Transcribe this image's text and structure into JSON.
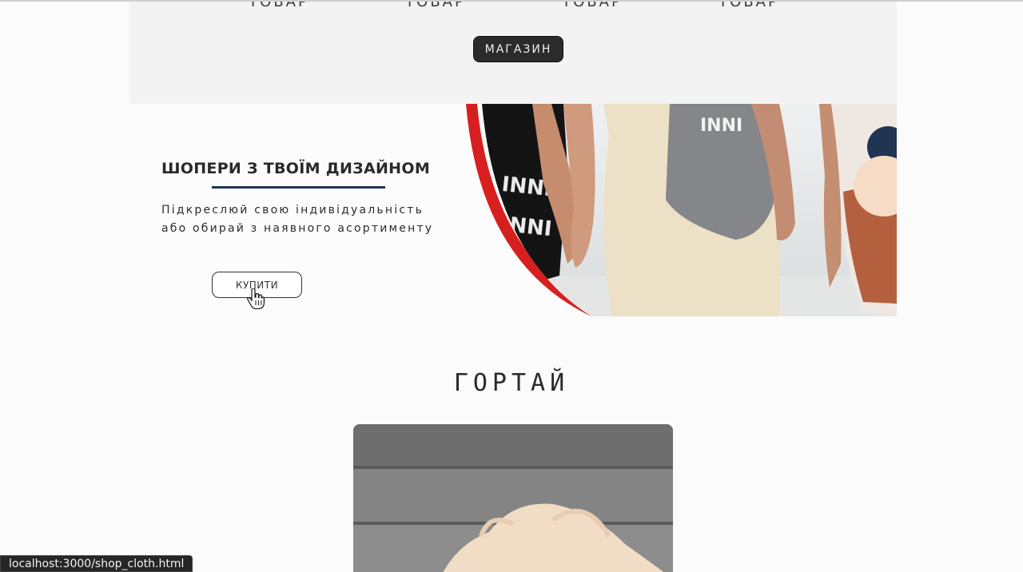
{
  "products": {
    "labels": [
      "ТОВАР",
      "ТОВАР",
      "ТОВАР",
      "ТОВАР"
    ],
    "shop_button": "МАГАЗИН"
  },
  "hero": {
    "title": "ШОПЕРИ З ТВОЇМ ДИЗАЙНОМ",
    "text_line1": "Підкреслюй свою індивідуальність",
    "text_line2": "або обирай з наявного асортименту",
    "buy_button": "КУПИТИ",
    "bag_print_1": "INNI",
    "bag_print_2": "INNI",
    "bag_print_3": "INNI"
  },
  "gallery": {
    "title": "ГОРТАЙ"
  },
  "status_bar": {
    "url": "localhost:3000/shop_cloth.html"
  },
  "colors": {
    "accent_navy": "#1f3551",
    "accent_red": "#d81f1f",
    "accent_peach": "#f6dcc6",
    "button_dark": "#2b2b2b"
  }
}
